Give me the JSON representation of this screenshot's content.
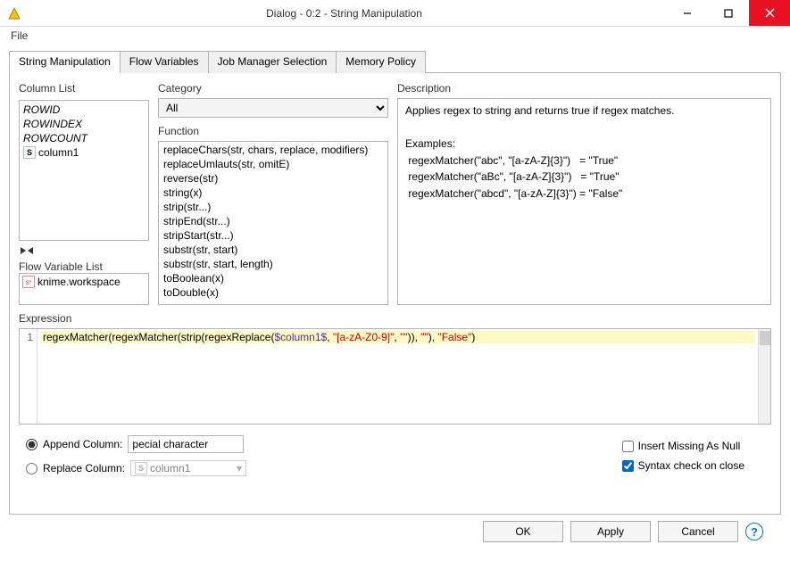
{
  "window": {
    "title": "Dialog - 0:2 - String Manipulation"
  },
  "menu": {
    "file": "File"
  },
  "tabs": [
    "String Manipulation",
    "Flow Variables",
    "Job Manager Selection",
    "Memory Policy"
  ],
  "active_tab": 0,
  "left": {
    "column_list_label": "Column List",
    "columns": [
      {
        "name": "ROWID",
        "italic": true
      },
      {
        "name": "ROWINDEX",
        "italic": true
      },
      {
        "name": "ROWCOUNT",
        "italic": true
      },
      {
        "name": "column1",
        "italic": false,
        "type": "S"
      }
    ],
    "flow_var_label": "Flow Variable List",
    "flow_vars": [
      {
        "name": "knime.workspace",
        "type": "sv"
      }
    ]
  },
  "mid": {
    "category_label": "Category",
    "category_value": "All",
    "function_label": "Function",
    "functions": [
      "replaceChars(str, chars, replace, modifiers)",
      "replaceUmlauts(str, omitE)",
      "reverse(str)",
      "string(x)",
      "strip(str...)",
      "stripEnd(str...)",
      "stripStart(str...)",
      "substr(str, start)",
      "substr(str, start, length)",
      "toBoolean(x)",
      "toDouble(x)"
    ]
  },
  "right": {
    "description_label": "Description",
    "desc_intro": "Applies regex to string and returns true if regex matches.",
    "desc_examples_label": "Examples:",
    "desc_rows": [
      " regexMatcher(\"abc\", \"[a-zA-Z]{3}\")   = \"True\"",
      " regexMatcher(\"aBc\", \"[a-zA-Z]{3}\")   = \"True\"",
      " regexMatcher(\"abcd\", \"[a-zA-Z]{3}\") = \"False\""
    ]
  },
  "expression": {
    "label": "Expression",
    "line_no": "1",
    "tokens": [
      {
        "t": "fn",
        "v": "regexMatcher"
      },
      {
        "t": "p",
        "v": "("
      },
      {
        "t": "fn",
        "v": "regexMatcher"
      },
      {
        "t": "p",
        "v": "("
      },
      {
        "t": "fn",
        "v": "strip"
      },
      {
        "t": "p",
        "v": "("
      },
      {
        "t": "fn",
        "v": "regexReplace"
      },
      {
        "t": "p",
        "v": "("
      },
      {
        "t": "var",
        "v": "$column1$"
      },
      {
        "t": "p",
        "v": ", "
      },
      {
        "t": "str",
        "v": "\"[a-zA-Z0-9]\""
      },
      {
        "t": "p",
        "v": ", "
      },
      {
        "t": "str",
        "v": "\"\""
      },
      {
        "t": "p",
        "v": ")), "
      },
      {
        "t": "str",
        "v": "\"\""
      },
      {
        "t": "p",
        "v": "), "
      },
      {
        "t": "str",
        "v": "\"False\""
      },
      {
        "t": "p",
        "v": ")"
      }
    ]
  },
  "options": {
    "append_label": "Append Column:",
    "append_value": "pecial character",
    "replace_label": "Replace Column:",
    "replace_value": "column1",
    "insert_null_label": "Insert Missing As Null",
    "syntax_check_label": "Syntax check on close",
    "append_selected": true,
    "insert_null_checked": false,
    "syntax_check_checked": true
  },
  "buttons": {
    "ok": "OK",
    "apply": "Apply",
    "cancel": "Cancel"
  }
}
